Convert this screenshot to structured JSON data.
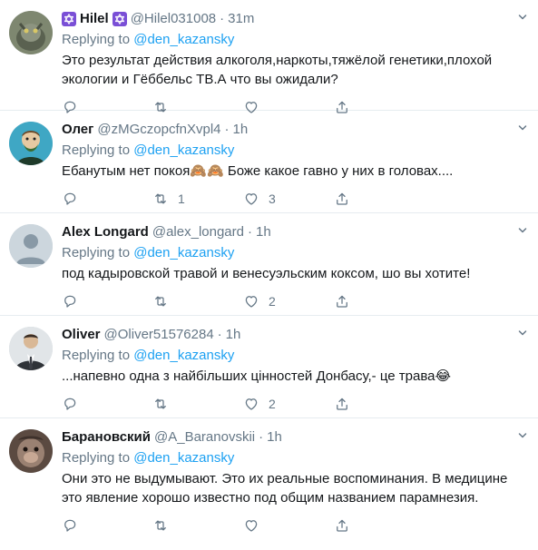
{
  "reply_prefix": "Replying to",
  "tweets": [
    {
      "name": "Hilel",
      "handle": "@Hilel031008",
      "separator": "·",
      "time": "31m",
      "reply_to": "@den_kazansky",
      "text": "Это результат действия алкоголя,наркоты,тяжёлой генетики,плохой экологии и Гёббельс ТВ.А что вы ожидали?",
      "replies": "",
      "retweets": "",
      "likes": ""
    },
    {
      "name": "Олег",
      "handle": "@zMGczopcfnXvpl4",
      "separator": "·",
      "time": "1h",
      "reply_to": "@den_kazansky",
      "text": "Ебанутым нет покоя🙈🙈 Боже какое гавно у них в головах....",
      "replies": "",
      "retweets": "1",
      "likes": "3"
    },
    {
      "name": "Alex Longard",
      "handle": "@alex_longard",
      "separator": "·",
      "time": "1h",
      "reply_to": "@den_kazansky",
      "text": "под кадыровской травой и венесуэльским коксом, шо вы хотите!",
      "replies": "",
      "retweets": "",
      "likes": "2"
    },
    {
      "name": "Oliver",
      "handle": "@Oliver51576284",
      "separator": "·",
      "time": "1h",
      "reply_to": "@den_kazansky",
      "text": "...напевно одна з найбільших цінностей Донбасу,- це трава😂",
      "replies": "",
      "retweets": "",
      "likes": "2"
    },
    {
      "name": "Барановский",
      "handle": "@A_Baranovskii",
      "separator": "·",
      "time": "1h",
      "reply_to": "@den_kazansky",
      "text": "Они это не выдумывают. Это их реальные воспоминания. В медицине это явление хорошо известно  под общим названием парамнезия.",
      "replies": "",
      "retweets": "",
      "likes": ""
    }
  ],
  "icons": {
    "reply": "reply-icon",
    "retweet": "retweet-icon",
    "like": "heart-icon",
    "share": "share-icon",
    "more": "chevron-down-icon",
    "badge": "star-of-david-icon"
  },
  "colors": {
    "link": "#1da1f2",
    "muted": "#657786",
    "text": "#14171a",
    "divider": "#e6ecf0",
    "badge": "#7a4fd6"
  }
}
